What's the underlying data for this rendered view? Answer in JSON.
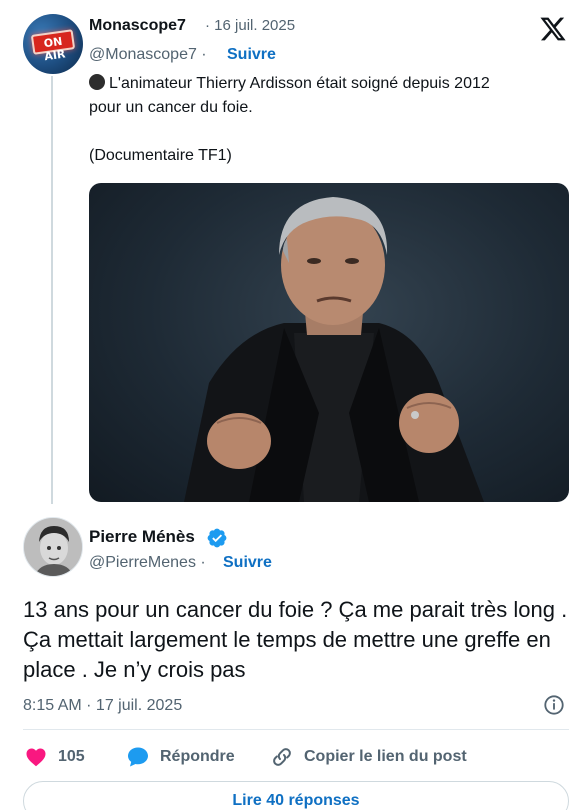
{
  "parent_tweet": {
    "author_name": "Monascope7",
    "date": "· 16 juil. 2025",
    "handle": "@Monascope7 ·",
    "follow_label": "Suivre",
    "avatar_text": "ON AIR",
    "text_line1": "L'animateur Thierry Ardisson était soigné depuis 2012",
    "text_line2": "pour un cancer du foie.",
    "text_line3": "(Documentaire TF1)",
    "photo_icon": "photo-of-man-portrait"
  },
  "main_tweet": {
    "author_name": "Pierre Ménès",
    "verified": true,
    "handle": "@PierreMenes ·",
    "follow_label": "Suivre",
    "text": "13 ans pour un cancer du foie ? Ça me parait très long . Ça mettait largement le temps de mettre une greffe en place . Je n’y crois pas",
    "timestamp": "8:15 AM · 17 juil. 2025"
  },
  "actions": {
    "like_count": "105",
    "reply_label": "Répondre",
    "copy_label": "Copier le lien du post"
  },
  "load_more_label": "Lire 40 réponses",
  "colors": {
    "accent": "#1d9bf0",
    "link": "#0f70c3",
    "like": "#f91880",
    "muted": "#536471"
  }
}
